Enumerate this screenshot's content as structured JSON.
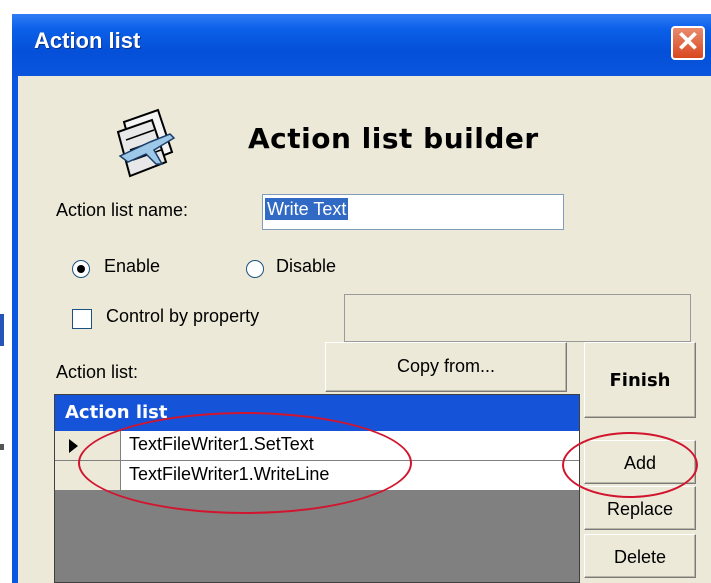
{
  "window": {
    "title": "Action list"
  },
  "header": {
    "heading": "Action list builder",
    "icon": "airplane-document-icon"
  },
  "form": {
    "name_label": "Action list name:",
    "name_value": "Write Text",
    "enable_label": "Enable",
    "disable_label": "Disable",
    "enable_checked": true,
    "control_label": "Control by property",
    "control_checked": false,
    "action_list_label": "Action list:"
  },
  "buttons": {
    "copy_from": "Copy from...",
    "finish": "Finish",
    "add": "Add",
    "replace": "Replace",
    "delete": "Delete"
  },
  "grid": {
    "header": "Action list",
    "rows": [
      "TextFileWriter1.SetText",
      "TextFileWriter1.WriteLine"
    ]
  },
  "colors": {
    "titlebar": "#0550d8",
    "annotation": "#d2152e",
    "grid_header": "#1554d8"
  }
}
